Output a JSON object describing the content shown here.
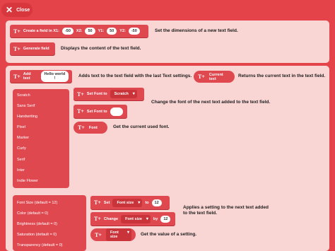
{
  "close_label": "Close",
  "block_icon": "T+",
  "section1": {
    "create": {
      "label": "Create a field in X1:",
      "x1": "-50",
      "x2_label": "X2:",
      "x2": "50",
      "y1_label": "Y1:",
      "y1": "50",
      "y2_label": "Y2:",
      "y2": "-50",
      "desc": "Set the dimensions of a new text field."
    },
    "generate": {
      "label": "Generate field",
      "desc": "Displays the content of the text field."
    }
  },
  "section2": {
    "add_text": {
      "label": "Add text",
      "value": "Hello world !",
      "desc": "Adds text to the text field with the last Text settings."
    },
    "current_text": {
      "label": "Current text",
      "desc": "Returns the current text in the text field."
    },
    "font_list": [
      "Scratch",
      "Sans Serif",
      "Handwriting",
      "Pixel",
      "Marker",
      "Curly",
      "Serif",
      "Inter",
      "Indie Flower"
    ],
    "set_font": {
      "label": "Set Font to",
      "value": "Scratch",
      "desc": "Change the font of the next text added to the text field."
    },
    "set_font_blank_label": "Set Font to",
    "font_reporter": {
      "label": "Font",
      "desc": "Get the current used font."
    },
    "settings_list": [
      "Font Size (default = 12)",
      "Color (default = 0)",
      "Brightness (default = 0)",
      "Saturation (default = 0)",
      "Transparency (default = 0)"
    ],
    "set_setting": {
      "label": "Set",
      "option": "Font size",
      "to": "to",
      "value": "12"
    },
    "change_setting": {
      "label": "Change",
      "option": "Font size",
      "by": "by",
      "value": "12"
    },
    "setting_desc": "Applies a setting to the next text added to the text field.",
    "setting_reporter": {
      "option": "Font size",
      "desc": "Get the value of a setting."
    }
  }
}
